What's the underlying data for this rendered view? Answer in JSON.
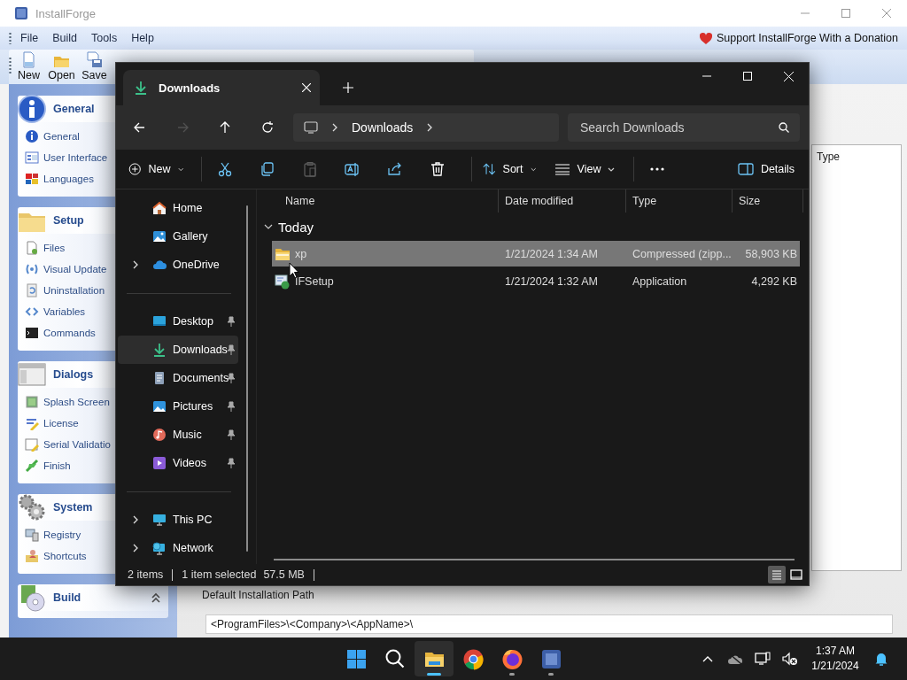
{
  "installforge": {
    "title": "InstallForge",
    "menu": [
      "File",
      "Build",
      "Tools",
      "Help"
    ],
    "support_link": "Support InstallForge With a Donation",
    "toolbar": [
      "New",
      "Open",
      "Save"
    ],
    "groups": [
      {
        "title": "General",
        "items": [
          "General",
          "User Interface",
          "Languages"
        ]
      },
      {
        "title": "Setup",
        "items": [
          "Files",
          "Visual Update",
          "Uninstallation",
          "Variables",
          "Commands"
        ]
      },
      {
        "title": "Dialogs",
        "items": [
          "Splash Screen",
          "License",
          "Serial Validatio",
          "Finish"
        ]
      },
      {
        "title": "System",
        "items": [
          "Registry",
          "Shortcuts"
        ]
      },
      {
        "title": "Build",
        "expanded": true
      }
    ],
    "column_header": "Type",
    "path_label": "Default Installation Path",
    "path_value": "<ProgramFiles>\\<Company>\\<AppName>\\"
  },
  "explorer": {
    "tab": "Downloads",
    "nav_buttons": [
      {
        "kind": "back",
        "disabled": false
      },
      {
        "kind": "forward",
        "disabled": true
      },
      {
        "kind": "up",
        "disabled": false
      },
      {
        "kind": "refresh",
        "disabled": false
      }
    ],
    "breadcrumb": "Downloads",
    "search": {
      "placeholder": "Search Downloads"
    },
    "commands": [
      {
        "kind": "new",
        "label": "New",
        "disabled": false
      },
      {
        "kind": "cut",
        "disabled": false
      },
      {
        "kind": "copy",
        "disabled": false
      },
      {
        "kind": "paste",
        "disabled": true
      },
      {
        "kind": "rename",
        "disabled": false
      },
      {
        "kind": "share",
        "disabled": false
      },
      {
        "kind": "delete",
        "disabled": false
      },
      {
        "kind": "sort",
        "label": "Sort",
        "disabled": false
      },
      {
        "kind": "view",
        "label": "View",
        "disabled": false
      },
      {
        "kind": "more",
        "disabled": false
      },
      {
        "kind": "details",
        "label": "Details",
        "disabled": false
      }
    ],
    "nav": [
      {
        "kind": "home",
        "label": "Home",
        "expandable": false,
        "pinned": false,
        "selected": false
      },
      {
        "kind": "gallery",
        "label": "Gallery",
        "expandable": false,
        "pinned": false,
        "selected": false
      },
      {
        "kind": "cloud",
        "label": "OneDrive",
        "expandable": true,
        "pinned": false,
        "selected": false
      },
      {
        "kind": "separator"
      },
      {
        "kind": "desktop",
        "label": "Desktop",
        "expandable": false,
        "pinned": true,
        "selected": false
      },
      {
        "kind": "downloads",
        "label": "Downloads",
        "expandable": false,
        "pinned": true,
        "selected": true
      },
      {
        "kind": "documents",
        "label": "Documents",
        "expandable": false,
        "pinned": true,
        "selected": false
      },
      {
        "kind": "pictures",
        "label": "Pictures",
        "expandable": false,
        "pinned": true,
        "selected": false
      },
      {
        "kind": "music",
        "label": "Music",
        "expandable": false,
        "pinned": true,
        "selected": false
      },
      {
        "kind": "videos",
        "label": "Videos",
        "expandable": false,
        "pinned": true,
        "selected": false
      },
      {
        "kind": "separator"
      },
      {
        "kind": "pc",
        "label": "This PC",
        "expandable": true,
        "pinned": false,
        "selected": false
      },
      {
        "kind": "network",
        "label": "Network",
        "expandable": true,
        "pinned": false,
        "selected": false
      }
    ],
    "columns": [
      "Name",
      "Date modified",
      "Type",
      "Size"
    ],
    "group": "Today",
    "rows": [
      {
        "kind": "zip",
        "name": "xp",
        "date": "1/21/2024 1:34 AM",
        "type": "Compressed (zipp...",
        "size": "58,903 KB",
        "selected": true
      },
      {
        "kind": "app",
        "name": "IFSetup",
        "date": "1/21/2024 1:32 AM",
        "type": "Application",
        "size": "4,292 KB",
        "selected": false
      }
    ],
    "status": [
      "2 items",
      "1 item selected",
      "57.5 MB"
    ],
    "view_buttons": [
      {
        "kind": "details",
        "selected": true
      },
      {
        "kind": "tiles",
        "selected": false
      }
    ]
  },
  "taskbar": {
    "apps": [
      {
        "kind": "start",
        "active": false,
        "running": false
      },
      {
        "kind": "search",
        "active": false,
        "running": false
      },
      {
        "kind": "explorer",
        "active": true,
        "running": true
      },
      {
        "kind": "chrome",
        "active": false,
        "running": false
      },
      {
        "kind": "firefox",
        "active": false,
        "running": true
      },
      {
        "kind": "installforge",
        "active": false,
        "running": true
      }
    ],
    "time": "1:37 AM",
    "date": "1/21/2024"
  }
}
